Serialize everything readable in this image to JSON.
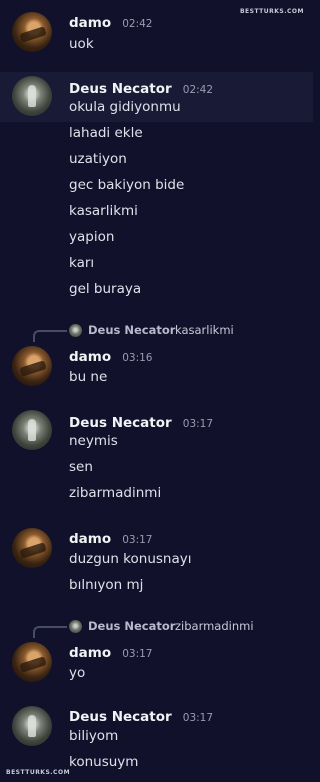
{
  "watermark": "BESTTURKS.COM",
  "messages": [
    {
      "author": "damo",
      "time": "02:42",
      "lines": [
        "uok"
      ]
    },
    {
      "author": "Deus Necator",
      "time": "02:42",
      "lines": [
        "okula gidiyonmu",
        "lahadi ekle",
        "uzatiyon",
        "gec bakiyon bide",
        "kasarlikmi",
        "yapion",
        "karı",
        "gel buraya"
      ]
    },
    {
      "author": "damo",
      "time": "03:16",
      "reply": {
        "author": "Deus Necator",
        "text": "kasarlikmi"
      },
      "lines": [
        "bu ne"
      ]
    },
    {
      "author": "Deus Necator",
      "time": "03:17",
      "lines": [
        "neymis",
        "sen",
        "zibarmadinmi"
      ]
    },
    {
      "author": "damo",
      "time": "03:17",
      "lines": [
        "duzgun konusnayı",
        "bılnıyon mj"
      ]
    },
    {
      "author": "damo",
      "time": "03:17",
      "reply": {
        "author": "Deus Necator",
        "text": "zibarmadinmi"
      },
      "lines": [
        "yo"
      ]
    },
    {
      "author": "Deus Necator",
      "time": "03:17",
      "lines": [
        "biliyom",
        "konusuym"
      ]
    }
  ]
}
